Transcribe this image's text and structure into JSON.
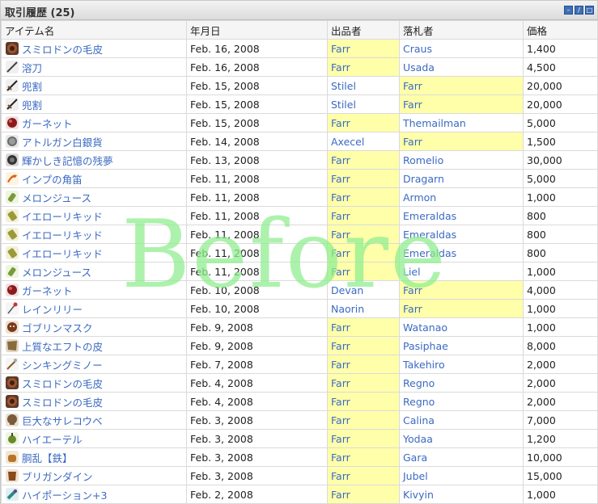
{
  "panel": {
    "title": "取引履歴 (25)",
    "buttons": [
      "minimize-icon",
      "edit-icon",
      "maximize-icon"
    ]
  },
  "table": {
    "headers": [
      "アイテム名",
      "年月日",
      "出品者",
      "落札者",
      "価格"
    ],
    "rows": [
      {
        "item": "スミロドンの毛皮",
        "date": "Feb. 16, 2008",
        "seller": "Farr",
        "buyer": "Craus",
        "price": "1,400",
        "icon": "pelt-icon",
        "hl": "seller"
      },
      {
        "item": "溶刀",
        "date": "Feb. 16, 2008",
        "seller": "Farr",
        "buyer": "Usada",
        "price": "4,500",
        "icon": "sword-icon",
        "hl": "seller"
      },
      {
        "item": "兜割",
        "date": "Feb. 15, 2008",
        "seller": "Stilel",
        "buyer": "Farr",
        "price": "20,000",
        "icon": "dagger-icon",
        "hl": "buyer"
      },
      {
        "item": "兜割",
        "date": "Feb. 15, 2008",
        "seller": "Stilel",
        "buyer": "Farr",
        "price": "20,000",
        "icon": "dagger-icon",
        "hl": "buyer"
      },
      {
        "item": "ガーネット",
        "date": "Feb. 15, 2008",
        "seller": "Farr",
        "buyer": "Themailman",
        "price": "5,000",
        "icon": "gem-icon",
        "hl": "seller"
      },
      {
        "item": "アトルガン白銀貨",
        "date": "Feb. 14, 2008",
        "seller": "Axecel",
        "buyer": "Farr",
        "price": "1,500",
        "icon": "coin-icon",
        "hl": "buyer"
      },
      {
        "item": "輝かしき記憶の残夢",
        "date": "Feb. 13, 2008",
        "seller": "Farr",
        "buyer": "Romelio",
        "price": "30,000",
        "icon": "orb-icon",
        "hl": "seller"
      },
      {
        "item": "インプの角笛",
        "date": "Feb. 11, 2008",
        "seller": "Farr",
        "buyer": "Dragarn",
        "price": "5,000",
        "icon": "horn-icon",
        "hl": "seller"
      },
      {
        "item": "メロンジュース",
        "date": "Feb. 11, 2008",
        "seller": "Farr",
        "buyer": "Armon",
        "price": "1,000",
        "icon": "bottle-icon",
        "hl": "seller"
      },
      {
        "item": "イエローリキッド",
        "date": "Feb. 11, 2008",
        "seller": "Farr",
        "buyer": "Emeraldas",
        "price": "800",
        "icon": "flask-icon",
        "hl": "seller"
      },
      {
        "item": "イエローリキッド",
        "date": "Feb. 11, 2008",
        "seller": "Farr",
        "buyer": "Emeraldas",
        "price": "800",
        "icon": "flask-icon",
        "hl": "seller"
      },
      {
        "item": "イエローリキッド",
        "date": "Feb. 11, 2008",
        "seller": "Farr",
        "buyer": "Emeraldas",
        "price": "800",
        "icon": "flask-icon",
        "hl": "seller"
      },
      {
        "item": "メロンジュース",
        "date": "Feb. 11, 2008",
        "seller": "Farr",
        "buyer": "Liel",
        "price": "1,000",
        "icon": "bottle-icon",
        "hl": "seller"
      },
      {
        "item": "ガーネット",
        "date": "Feb. 10, 2008",
        "seller": "Devan",
        "buyer": "Farr",
        "price": "4,000",
        "icon": "gem-icon",
        "hl": "buyer"
      },
      {
        "item": "レインリリー",
        "date": "Feb. 10, 2008",
        "seller": "Naorin",
        "buyer": "Farr",
        "price": "1,000",
        "icon": "flower-icon",
        "hl": "buyer"
      },
      {
        "item": "ゴブリンマスク",
        "date": "Feb. 9, 2008",
        "seller": "Farr",
        "buyer": "Watanao",
        "price": "1,000",
        "icon": "mask-icon",
        "hl": "seller"
      },
      {
        "item": "上質なエフトの皮",
        "date": "Feb. 9, 2008",
        "seller": "Farr",
        "buyer": "Pasiphae",
        "price": "8,000",
        "icon": "hide-icon",
        "hl": "seller"
      },
      {
        "item": "シンキングミノー",
        "date": "Feb. 7, 2008",
        "seller": "Farr",
        "buyer": "Takehiro",
        "price": "2,000",
        "icon": "lure-icon",
        "hl": "seller"
      },
      {
        "item": "スミロドンの毛皮",
        "date": "Feb. 4, 2008",
        "seller": "Farr",
        "buyer": "Regno",
        "price": "2,000",
        "icon": "pelt-icon",
        "hl": "seller"
      },
      {
        "item": "スミロドンの毛皮",
        "date": "Feb. 4, 2008",
        "seller": "Farr",
        "buyer": "Regno",
        "price": "2,000",
        "icon": "pelt-icon",
        "hl": "seller"
      },
      {
        "item": "巨大なサレコウベ",
        "date": "Feb. 3, 2008",
        "seller": "Farr",
        "buyer": "Calina",
        "price": "7,000",
        "icon": "skull-icon",
        "hl": "seller"
      },
      {
        "item": "ハイエーテル",
        "date": "Feb. 3, 2008",
        "seller": "Farr",
        "buyer": "Yodaa",
        "price": "1,200",
        "icon": "potion-icon",
        "hl": "seller"
      },
      {
        "item": "胴乱【鉄】",
        "date": "Feb. 3, 2008",
        "seller": "Farr",
        "buyer": "Gara",
        "price": "10,000",
        "icon": "pouch-icon",
        "hl": "seller"
      },
      {
        "item": "ブリガンダイン",
        "date": "Feb. 3, 2008",
        "seller": "Farr",
        "buyer": "Jubel",
        "price": "15,000",
        "icon": "armor-icon",
        "hl": "seller"
      },
      {
        "item": "ハイポーション+3",
        "date": "Feb. 2, 2008",
        "seller": "Farr",
        "buyer": "Kivyin",
        "price": "1,000",
        "icon": "elixir-icon",
        "hl": "seller"
      }
    ]
  },
  "watermark": "Before",
  "colors": {
    "link": "#3b6ac2",
    "highlight": "#ffffaa",
    "watermark": "#90ee90"
  }
}
